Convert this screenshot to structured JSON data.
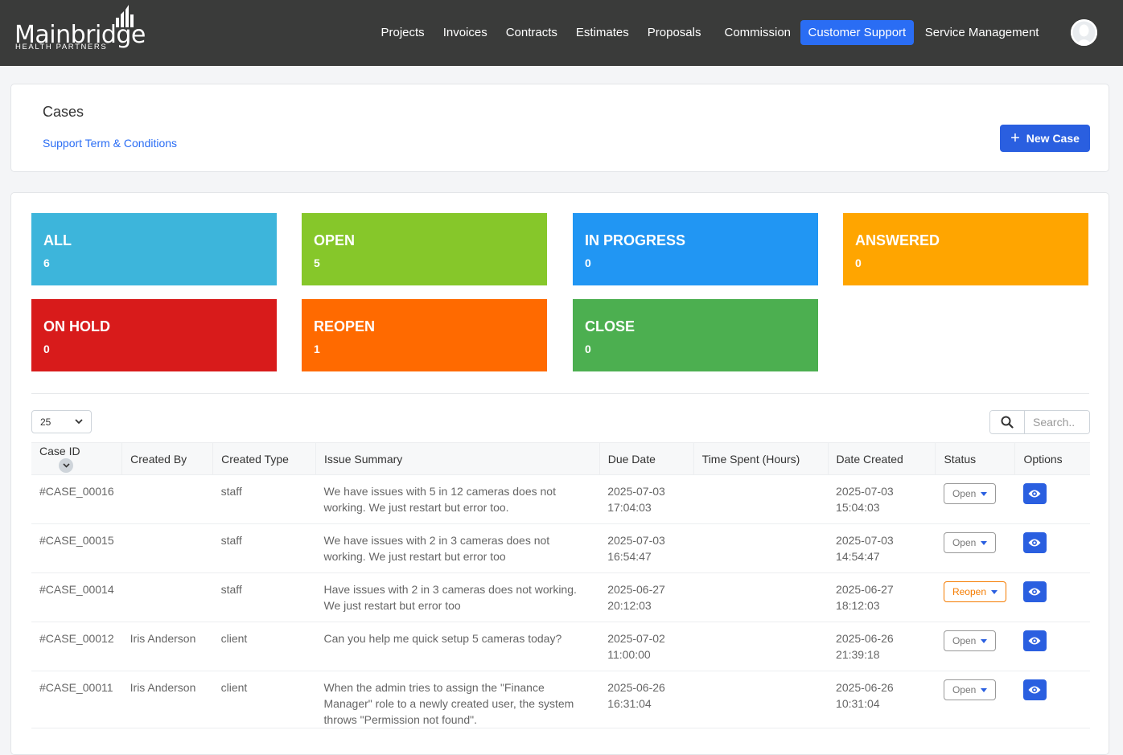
{
  "brand": {
    "name": "Mainbridge",
    "tagline": "HEALTH PARTNERS"
  },
  "nav": {
    "items": [
      {
        "label": "Projects"
      },
      {
        "label": "Invoices"
      },
      {
        "label": "Contracts"
      },
      {
        "label": "Estimates"
      },
      {
        "label": "Proposals"
      },
      {
        "label": "Commission"
      },
      {
        "label": "Customer Support",
        "active": true
      },
      {
        "label": "Service Management"
      }
    ],
    "active_color": "#2a6df4"
  },
  "header": {
    "title": "Cases",
    "terms_link": "Support Term & Conditions",
    "new_case_label": "New Case"
  },
  "stats": [
    {
      "label": "ALL",
      "count": "6",
      "color": "#3db5db"
    },
    {
      "label": "OPEN",
      "count": "5",
      "color": "#86c72a"
    },
    {
      "label": "IN PROGRESS",
      "count": "0",
      "color": "#2196f3"
    },
    {
      "label": "ANSWERED",
      "count": "0",
      "color": "#ffa500"
    },
    {
      "label": "ON HOLD",
      "count": "0",
      "color": "#d81b1b"
    },
    {
      "label": "REOPEN",
      "count": "1",
      "color": "#ff6a00"
    },
    {
      "label": "CLOSE",
      "count": "0",
      "color": "#4caf50"
    }
  ],
  "table_controls": {
    "page_size": "25",
    "search_placeholder": "Search.."
  },
  "table": {
    "columns": [
      "Case ID",
      "Created By",
      "Created Type",
      "Issue Summary",
      "Due Date",
      "Time Spent (Hours)",
      "Date Created",
      "Status",
      "Options"
    ],
    "rows": [
      {
        "case_id": "#CASE_00016",
        "created_by": "",
        "created_type": "staff",
        "summary": "We have issues with 5 in 12 cameras does not working. We just restart but error too.",
        "due_date": "2025-07-03",
        "due_time": "17:04:03",
        "time_spent": "",
        "created_date": "2025-07-03",
        "created_time": "15:04:03",
        "status": "Open"
      },
      {
        "case_id": "#CASE_00015",
        "created_by": "",
        "created_type": "staff",
        "summary": "We have issues with 2 in 3 cameras does not working. We just restart but error too",
        "due_date": "2025-07-03",
        "due_time": "16:54:47",
        "time_spent": "",
        "created_date": "2025-07-03",
        "created_time": "14:54:47",
        "status": "Open"
      },
      {
        "case_id": "#CASE_00014",
        "created_by": "",
        "created_type": "staff",
        "summary": "Have issues with 2 in 3 cameras does not working. We just restart but error too",
        "due_date": "2025-06-27",
        "due_time": "20:12:03",
        "time_spent": "",
        "created_date": "2025-06-27",
        "created_time": "18:12:03",
        "status": "Reopen"
      },
      {
        "case_id": "#CASE_00012",
        "created_by": "Iris Anderson",
        "created_type": "client",
        "summary": "Can you help me quick setup 5 cameras today?",
        "due_date": "2025-07-02",
        "due_time": "11:00:00",
        "time_spent": "",
        "created_date": "2025-06-26",
        "created_time": "21:39:18",
        "status": "Open"
      },
      {
        "case_id": "#CASE_00011",
        "created_by": "Iris Anderson",
        "created_type": "client",
        "summary": "When the admin tries to assign the \"Finance Manager\" role to a newly created user, the system throws \"Permission not found\".",
        "due_date": "2025-06-26",
        "due_time": "16:31:04",
        "time_spent": "",
        "created_date": "2025-06-26",
        "created_time": "10:31:04",
        "status": "Open"
      }
    ]
  }
}
